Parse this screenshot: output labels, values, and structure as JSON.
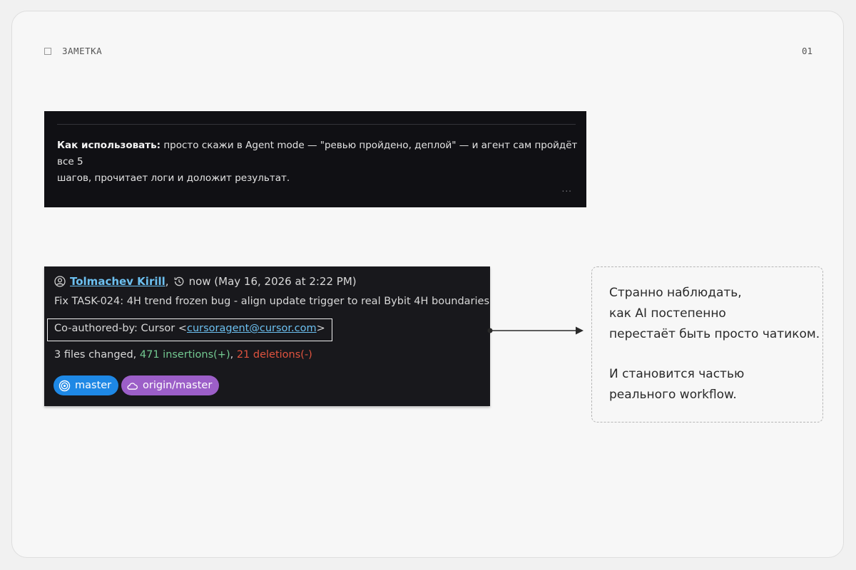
{
  "header": {
    "label": "ЗАМЕТКА",
    "number": "01"
  },
  "panel1": {
    "bold_label": "Как использовать:",
    "line1_rest": " просто скажи в Agent mode — \"ревью пройдено, деплой\" — и агент сам пройдёт все 5",
    "line2": "шагов, прочитает логи и доложит результат.",
    "more": "..."
  },
  "commit": {
    "author": "Tolmachev Kirill",
    "comma": ",",
    "time": "now (May 16, 2026 at 2:22 PM)",
    "message": "Fix TASK-024: 4H trend frozen bug - align update trigger to real Bybit 4H boundaries",
    "coauthor_prefix": "Co-authored-by: Cursor <",
    "coauthor_email": "cursoragent@cursor.com",
    "coauthor_suffix": ">",
    "stats_prefix": "3 files changed, ",
    "insertions": "471 insertions(+)",
    "stats_sep": ", ",
    "deletions": "21 deletions(-)",
    "branches": [
      {
        "label": "master",
        "icon": "target-icon",
        "color": "#1e88e5"
      },
      {
        "label": "origin/master",
        "icon": "cloud-icon",
        "color": "#9c5fc8"
      }
    ]
  },
  "note": {
    "lines": [
      "Странно наблюдать,",
      "как AI постепенно",
      "перестаёт быть просто чатиком.",
      "",
      "И становится частью",
      "реального workflow."
    ]
  }
}
